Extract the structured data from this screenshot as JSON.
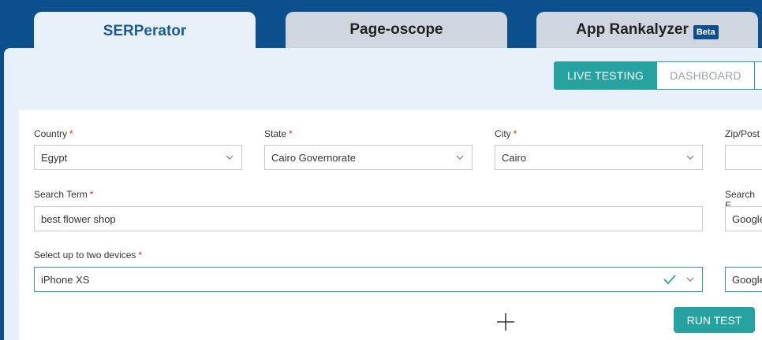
{
  "tabs": [
    {
      "label": "SERPerator",
      "active": true
    },
    {
      "label": "Page-oscope",
      "active": false
    },
    {
      "label": "App Rankalyzer",
      "badge": "Beta",
      "active": false
    }
  ],
  "mode_switch": {
    "live_label": "LIVE TESTING",
    "dashboard_label": "DASHBOARD"
  },
  "form": {
    "country": {
      "label": "Country",
      "required": "*",
      "value": "Egypt"
    },
    "state": {
      "label": "State",
      "required": "*",
      "value": "Cairo Governorate"
    },
    "city": {
      "label": "City",
      "required": "*",
      "value": "Cairo"
    },
    "zip": {
      "label": "Zip/Post",
      "value": ""
    },
    "search_term": {
      "label": "Search Term",
      "required": "*",
      "value": "best flower shop"
    },
    "search_engine": {
      "label": "Search E",
      "value": "Google"
    },
    "devices": {
      "label": "Select up to two devices",
      "required": "*",
      "value": "iPhone XS"
    },
    "engine_domain": {
      "value": "Google"
    }
  },
  "run_button": {
    "label": "RUN TEST"
  },
  "colors": {
    "brand_blue": "#0b4f8c",
    "teal": "#26a3a0",
    "required_red": "#d32f2f"
  }
}
